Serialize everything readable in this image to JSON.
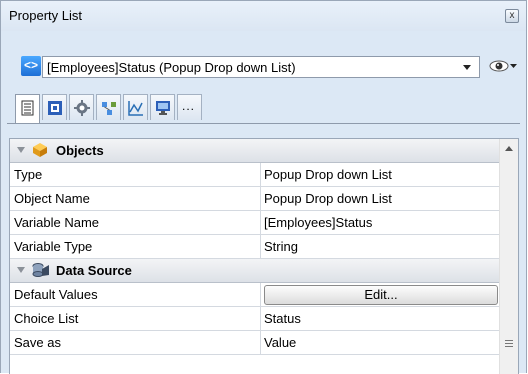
{
  "window": {
    "title": "Property List",
    "close_glyph": "x"
  },
  "object_selector": {
    "nav_glyph": "<>",
    "selected": "[Employees]Status (Popup Drop down List)"
  },
  "tabs": [
    "list-icon",
    "object-icon",
    "gear-icon",
    "hierarchy-icon",
    "chart-icon",
    "display-icon",
    "more-icon"
  ],
  "tab_more_glyph": "...",
  "sections": [
    {
      "label": "Objects",
      "rows": [
        {
          "name": "Type",
          "value": "Popup Drop down List"
        },
        {
          "name": "Object Name",
          "value": "Popup Drop down List"
        },
        {
          "name": "Variable Name",
          "value": "[Employees]Status"
        },
        {
          "name": "Variable Type",
          "value": "String"
        }
      ]
    },
    {
      "label": "Data Source",
      "rows": [
        {
          "name": "Default Values",
          "value": "Edit..."
        },
        {
          "name": "Choice List",
          "value": "Status"
        },
        {
          "name": "Save as",
          "value": "Value"
        }
      ]
    }
  ],
  "colors": {
    "panel_bg": "#dce8f5",
    "accent": "#1d6fd6"
  }
}
